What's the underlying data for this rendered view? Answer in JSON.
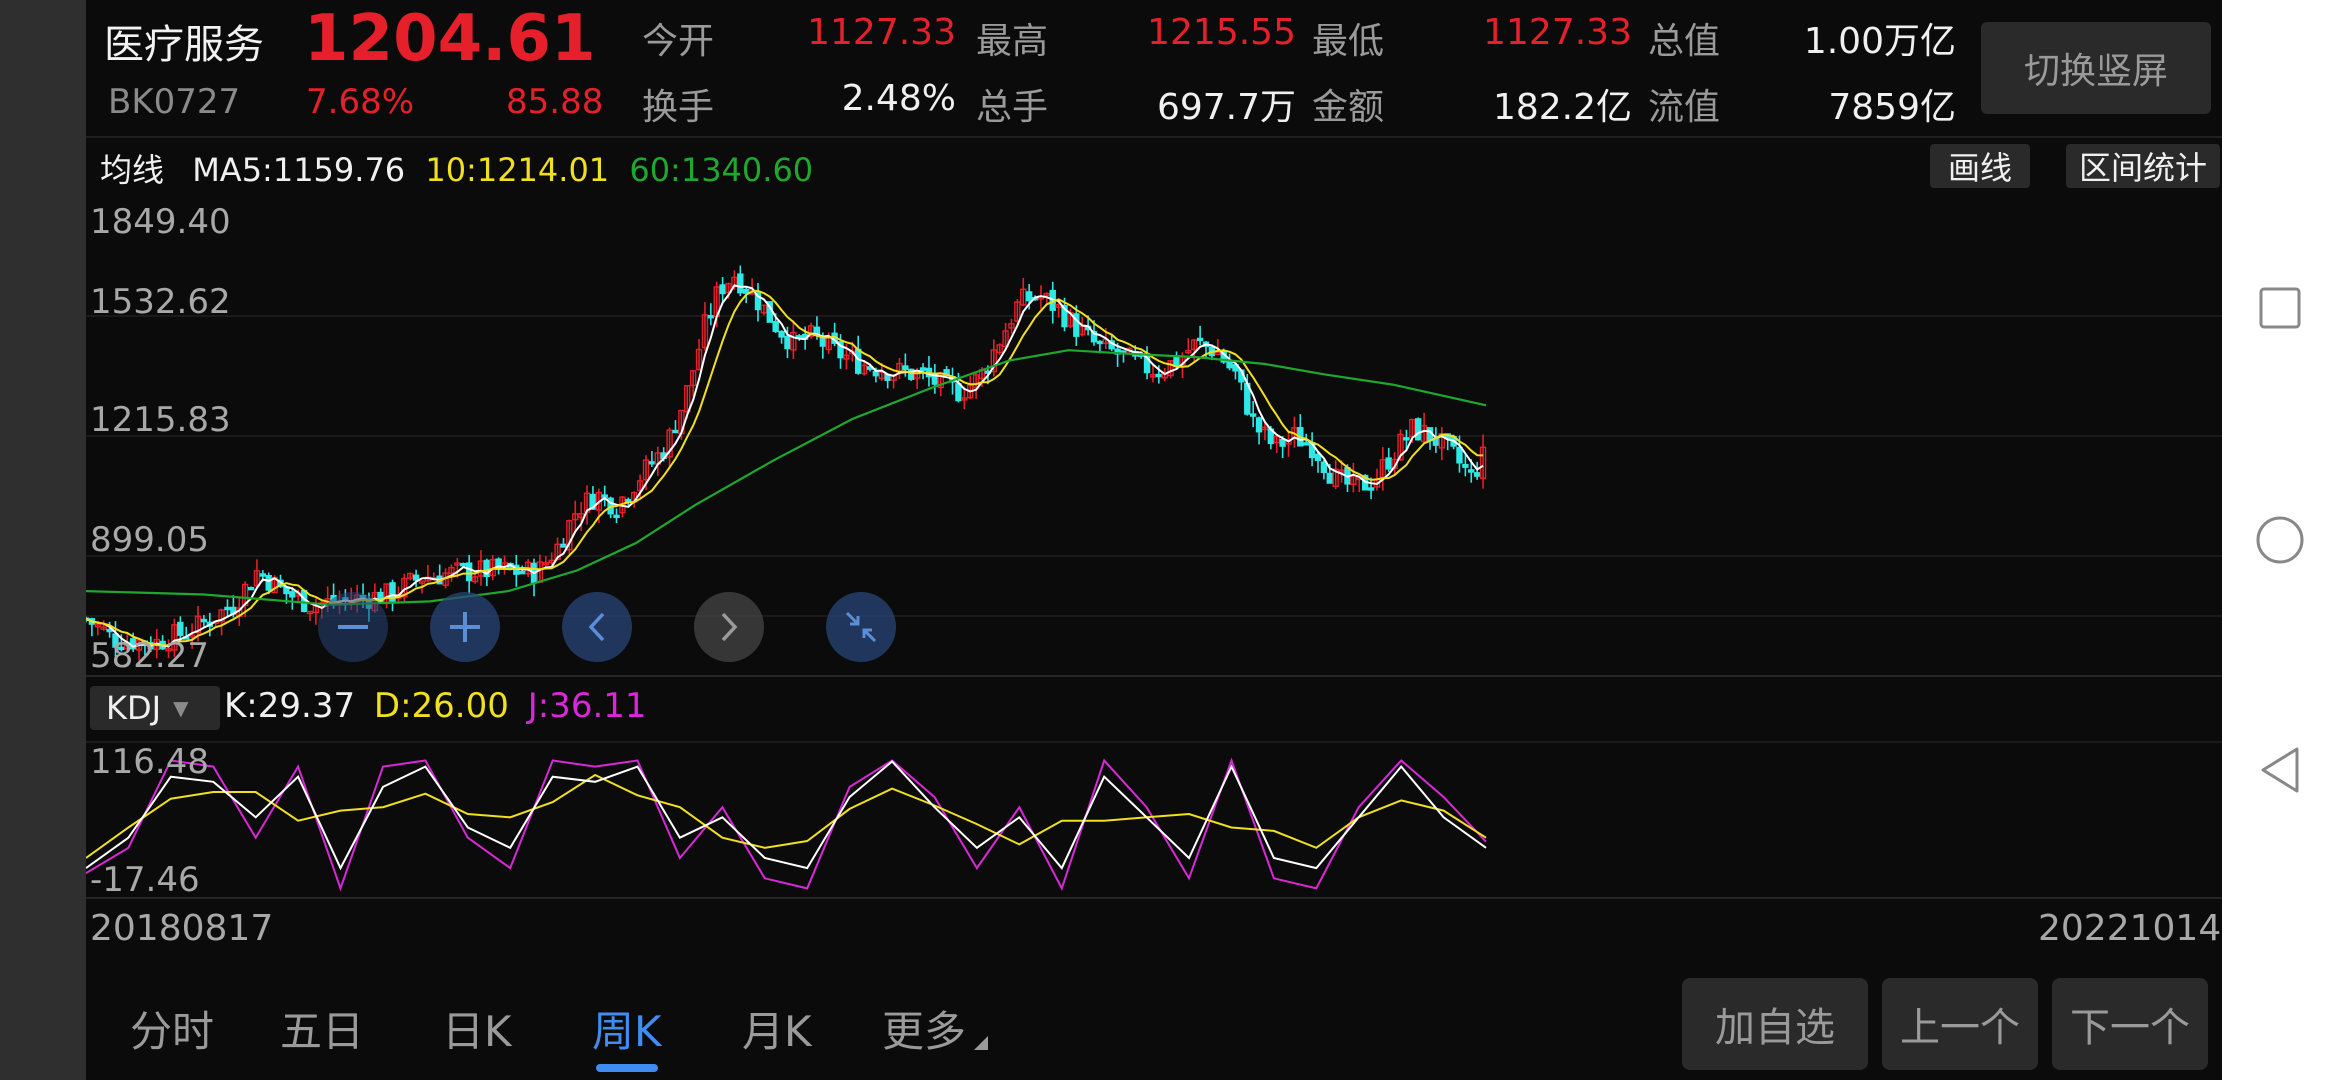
{
  "header": {
    "name": "医疗服务",
    "price": "1204.61",
    "code": "BK0727",
    "change_pct": "7.68%",
    "change": "85.88",
    "switch_label": "切换竖屏"
  },
  "stats": [
    {
      "label": "今开",
      "value": "1127.33",
      "color": "#e5202a"
    },
    {
      "label": "最高",
      "value": "1215.55",
      "color": "#e5202a"
    },
    {
      "label": "最低",
      "value": "1127.33",
      "color": "#e5202a"
    },
    {
      "label": "总值",
      "value": "1.00万亿",
      "color": "#f0f0f0"
    },
    {
      "label": "换手",
      "value": "2.48%",
      "color": "#f0f0f0"
    },
    {
      "label": "总手",
      "value": "697.7万",
      "color": "#f0f0f0"
    },
    {
      "label": "金额",
      "value": "182.2亿",
      "color": "#f0f0f0"
    },
    {
      "label": "流值",
      "value": "7859亿",
      "color": "#f0f0f0"
    }
  ],
  "ma": {
    "label": "均线",
    "ma5": "MA5:1159.76",
    "ma10": "10:1214.01",
    "ma60": "60:1340.60"
  },
  "tools": {
    "draw": "画线",
    "range_stats": "区间统计"
  },
  "price_axis": [
    "1849.40",
    "1532.62",
    "1215.83",
    "899.05",
    "582.27"
  ],
  "kdj": {
    "label": "KDJ",
    "k": "K:29.37",
    "d": "D:26.00",
    "j": "J:36.11",
    "axis": [
      "116.48",
      "-17.46"
    ]
  },
  "dates": {
    "start": "20180817",
    "end": "20221014"
  },
  "tabs": [
    "分时",
    "五日",
    "日K",
    "周K",
    "月K",
    "更多"
  ],
  "active_tab": "周K",
  "bottom_buttons": [
    "加自选",
    "上一个",
    "下一个"
  ],
  "colors": {
    "up": "#e5202a",
    "down": "#2ee8e6",
    "ma5": "#ffffff",
    "ma10": "#f0e020",
    "ma60": "#1fa82e",
    "k": "#ffffff",
    "d": "#f0e020",
    "j": "#d828d8",
    "accent": "#3f8df0"
  },
  "chart_data": [
    {
      "type": "candlestick",
      "title": "",
      "ylim": [
        582.27,
        1849.4
      ],
      "trend_points": [
        [
          0,
          720
        ],
        [
          30,
          660
        ],
        [
          70,
          650
        ],
        [
          110,
          690
        ],
        [
          150,
          760
        ],
        [
          175,
          860
        ],
        [
          200,
          800
        ],
        [
          230,
          760
        ],
        [
          270,
          775
        ],
        [
          310,
          790
        ],
        [
          340,
          840
        ],
        [
          380,
          855
        ],
        [
          420,
          860
        ],
        [
          460,
          855
        ],
        [
          480,
          930
        ],
        [
          500,
          1040
        ],
        [
          520,
          1080
        ],
        [
          540,
          1050
        ],
        [
          560,
          1120
        ],
        [
          590,
          1220
        ],
        [
          610,
          1360
        ],
        [
          630,
          1570
        ],
        [
          645,
          1680
        ],
        [
          660,
          1720
        ],
        [
          680,
          1660
        ],
        [
          700,
          1580
        ],
        [
          720,
          1520
        ],
        [
          740,
          1540
        ],
        [
          760,
          1500
        ],
        [
          790,
          1460
        ],
        [
          820,
          1440
        ],
        [
          850,
          1430
        ],
        [
          870,
          1400
        ],
        [
          890,
          1380
        ],
        [
          910,
          1420
        ],
        [
          930,
          1530
        ],
        [
          950,
          1640
        ],
        [
          970,
          1660
        ],
        [
          990,
          1620
        ],
        [
          1010,
          1560
        ],
        [
          1030,
          1510
        ],
        [
          1050,
          1490
        ],
        [
          1070,
          1460
        ],
        [
          1090,
          1440
        ],
        [
          1110,
          1470
        ],
        [
          1130,
          1520
        ],
        [
          1150,
          1500
        ],
        [
          1170,
          1430
        ],
        [
          1190,
          1280
        ],
        [
          1210,
          1220
        ],
        [
          1230,
          1250
        ],
        [
          1250,
          1220
        ],
        [
          1270,
          1130
        ],
        [
          1290,
          1100
        ],
        [
          1310,
          1120
        ],
        [
          1330,
          1200
        ],
        [
          1350,
          1270
        ],
        [
          1370,
          1250
        ],
        [
          1390,
          1200
        ],
        [
          1410,
          1130
        ],
        [
          1425,
          1204
        ]
      ],
      "ma60_points": [
        [
          0,
          800
        ],
        [
          120,
          790
        ],
        [
          250,
          760
        ],
        [
          350,
          770
        ],
        [
          430,
          800
        ],
        [
          500,
          860
        ],
        [
          560,
          940
        ],
        [
          620,
          1050
        ],
        [
          700,
          1180
        ],
        [
          780,
          1300
        ],
        [
          860,
          1390
        ],
        [
          940,
          1470
        ],
        [
          1000,
          1500
        ],
        [
          1060,
          1490
        ],
        [
          1130,
          1480
        ],
        [
          1200,
          1460
        ],
        [
          1260,
          1430
        ],
        [
          1330,
          1400
        ],
        [
          1425,
          1340
        ]
      ]
    },
    {
      "type": "line",
      "title": "KDJ",
      "ylim": [
        -17.46,
        116.48
      ],
      "series": [
        {
          "name": "K",
          "values": [
            10,
            40,
            100,
            95,
            60,
            100,
            10,
            90,
            110,
            50,
            30,
            100,
            95,
            110,
            40,
            60,
            20,
            10,
            80,
            115,
            70,
            30,
            60,
            10,
            100,
            60,
            20,
            110,
            20,
            10,
            60,
            110,
            60,
            30
          ]
        },
        {
          "name": "J",
          "values": [
            5,
            30,
            116,
            110,
            40,
            110,
            -10,
            110,
            116,
            40,
            10,
            116,
            110,
            116,
            20,
            70,
            0,
            -10,
            90,
            116,
            80,
            10,
            70,
            -10,
            116,
            70,
            0,
            116,
            0,
            -10,
            70,
            116,
            80,
            36
          ]
        }
      ]
    }
  ]
}
